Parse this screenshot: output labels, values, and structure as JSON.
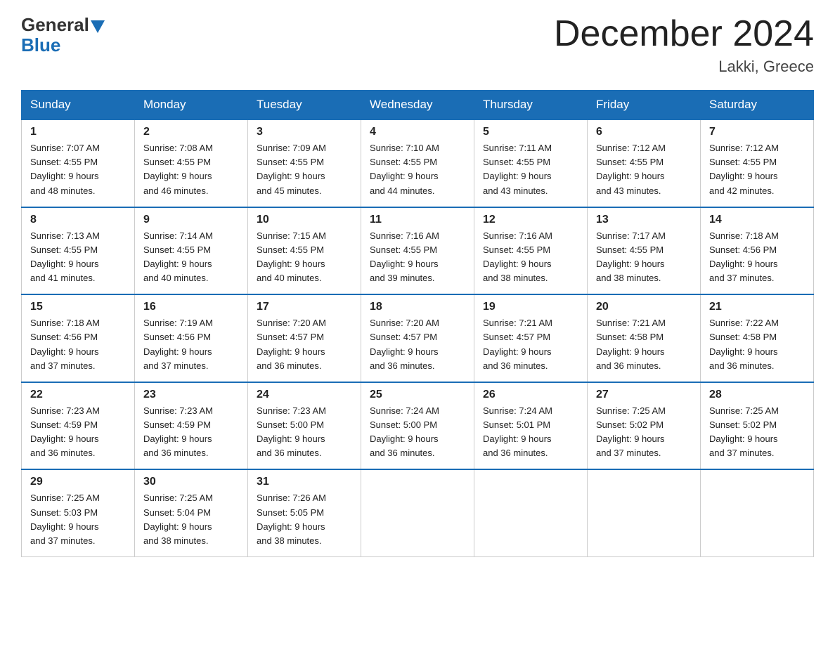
{
  "header": {
    "logo": {
      "general": "General",
      "blue": "Blue"
    },
    "title": "December 2024",
    "subtitle": "Lakki, Greece"
  },
  "days_of_week": [
    "Sunday",
    "Monday",
    "Tuesday",
    "Wednesday",
    "Thursday",
    "Friday",
    "Saturday"
  ],
  "weeks": [
    [
      {
        "day": "1",
        "sunrise": "7:07 AM",
        "sunset": "4:55 PM",
        "daylight": "9 hours and 48 minutes."
      },
      {
        "day": "2",
        "sunrise": "7:08 AM",
        "sunset": "4:55 PM",
        "daylight": "9 hours and 46 minutes."
      },
      {
        "day": "3",
        "sunrise": "7:09 AM",
        "sunset": "4:55 PM",
        "daylight": "9 hours and 45 minutes."
      },
      {
        "day": "4",
        "sunrise": "7:10 AM",
        "sunset": "4:55 PM",
        "daylight": "9 hours and 44 minutes."
      },
      {
        "day": "5",
        "sunrise": "7:11 AM",
        "sunset": "4:55 PM",
        "daylight": "9 hours and 43 minutes."
      },
      {
        "day": "6",
        "sunrise": "7:12 AM",
        "sunset": "4:55 PM",
        "daylight": "9 hours and 43 minutes."
      },
      {
        "day": "7",
        "sunrise": "7:12 AM",
        "sunset": "4:55 PM",
        "daylight": "9 hours and 42 minutes."
      }
    ],
    [
      {
        "day": "8",
        "sunrise": "7:13 AM",
        "sunset": "4:55 PM",
        "daylight": "9 hours and 41 minutes."
      },
      {
        "day": "9",
        "sunrise": "7:14 AM",
        "sunset": "4:55 PM",
        "daylight": "9 hours and 40 minutes."
      },
      {
        "day": "10",
        "sunrise": "7:15 AM",
        "sunset": "4:55 PM",
        "daylight": "9 hours and 40 minutes."
      },
      {
        "day": "11",
        "sunrise": "7:16 AM",
        "sunset": "4:55 PM",
        "daylight": "9 hours and 39 minutes."
      },
      {
        "day": "12",
        "sunrise": "7:16 AM",
        "sunset": "4:55 PM",
        "daylight": "9 hours and 38 minutes."
      },
      {
        "day": "13",
        "sunrise": "7:17 AM",
        "sunset": "4:55 PM",
        "daylight": "9 hours and 38 minutes."
      },
      {
        "day": "14",
        "sunrise": "7:18 AM",
        "sunset": "4:56 PM",
        "daylight": "9 hours and 37 minutes."
      }
    ],
    [
      {
        "day": "15",
        "sunrise": "7:18 AM",
        "sunset": "4:56 PM",
        "daylight": "9 hours and 37 minutes."
      },
      {
        "day": "16",
        "sunrise": "7:19 AM",
        "sunset": "4:56 PM",
        "daylight": "9 hours and 37 minutes."
      },
      {
        "day": "17",
        "sunrise": "7:20 AM",
        "sunset": "4:57 PM",
        "daylight": "9 hours and 36 minutes."
      },
      {
        "day": "18",
        "sunrise": "7:20 AM",
        "sunset": "4:57 PM",
        "daylight": "9 hours and 36 minutes."
      },
      {
        "day": "19",
        "sunrise": "7:21 AM",
        "sunset": "4:57 PM",
        "daylight": "9 hours and 36 minutes."
      },
      {
        "day": "20",
        "sunrise": "7:21 AM",
        "sunset": "4:58 PM",
        "daylight": "9 hours and 36 minutes."
      },
      {
        "day": "21",
        "sunrise": "7:22 AM",
        "sunset": "4:58 PM",
        "daylight": "9 hours and 36 minutes."
      }
    ],
    [
      {
        "day": "22",
        "sunrise": "7:23 AM",
        "sunset": "4:59 PM",
        "daylight": "9 hours and 36 minutes."
      },
      {
        "day": "23",
        "sunrise": "7:23 AM",
        "sunset": "4:59 PM",
        "daylight": "9 hours and 36 minutes."
      },
      {
        "day": "24",
        "sunrise": "7:23 AM",
        "sunset": "5:00 PM",
        "daylight": "9 hours and 36 minutes."
      },
      {
        "day": "25",
        "sunrise": "7:24 AM",
        "sunset": "5:00 PM",
        "daylight": "9 hours and 36 minutes."
      },
      {
        "day": "26",
        "sunrise": "7:24 AM",
        "sunset": "5:01 PM",
        "daylight": "9 hours and 36 minutes."
      },
      {
        "day": "27",
        "sunrise": "7:25 AM",
        "sunset": "5:02 PM",
        "daylight": "9 hours and 37 minutes."
      },
      {
        "day": "28",
        "sunrise": "7:25 AM",
        "sunset": "5:02 PM",
        "daylight": "9 hours and 37 minutes."
      }
    ],
    [
      {
        "day": "29",
        "sunrise": "7:25 AM",
        "sunset": "5:03 PM",
        "daylight": "9 hours and 37 minutes."
      },
      {
        "day": "30",
        "sunrise": "7:25 AM",
        "sunset": "5:04 PM",
        "daylight": "9 hours and 38 minutes."
      },
      {
        "day": "31",
        "sunrise": "7:26 AM",
        "sunset": "5:05 PM",
        "daylight": "9 hours and 38 minutes."
      },
      null,
      null,
      null,
      null
    ]
  ],
  "labels": {
    "sunrise": "Sunrise:",
    "sunset": "Sunset:",
    "daylight": "Daylight:"
  }
}
